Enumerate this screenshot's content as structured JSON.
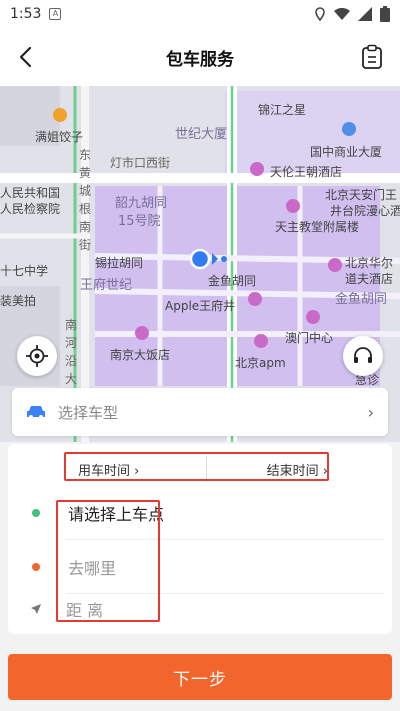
{
  "status_bar": {
    "time": "1:53",
    "app_glyph": "A"
  },
  "header": {
    "title": "包车服务",
    "back_icon": "back-arrow-icon",
    "menu_icon": "clipboard-icon"
  },
  "map": {
    "labels": [
      "满姐饺子",
      "世纪大厦",
      "锦江之星",
      "国中商业大厦",
      "灯市口西街",
      "东",
      "黄",
      "城",
      "根",
      "南",
      "街",
      "天伦王朝酒店",
      "人民共和国",
      "人民检察院",
      "韶九胡同",
      "15号院",
      "北京天安门王",
      "井台院漫心酒",
      "天主教堂附属楼",
      "锡拉胡同",
      "金鱼胡同",
      "北京华尔",
      "道夫酒店",
      "王府世纪",
      "Apple王府井",
      "金鱼胡同",
      "南",
      "河",
      "沿",
      "大",
      "街",
      "南京大饭店",
      "澳门中心",
      "北京apm",
      "急诊",
      "十七中学",
      "装美拍"
    ]
  },
  "car_type": {
    "placeholder": "选择车型",
    "chevron": "›"
  },
  "time_row": {
    "start_label": "用车时间 ›",
    "end_label": "结束时间 ›"
  },
  "locations": {
    "pickup": "请选择上车点",
    "destination": "去哪里",
    "distance": "距 离"
  },
  "next_button": "下一步",
  "colors": {
    "accent": "#f2662d",
    "pickup_dot": "#3ec07f",
    "dest_dot": "#f2662d",
    "highlight": "#e53935"
  }
}
